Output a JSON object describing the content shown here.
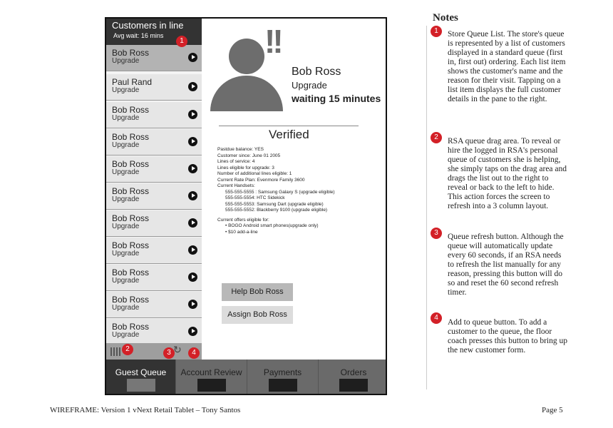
{
  "queue": {
    "title": "Customers in line",
    "avg_wait": "Avg wait: 16 mins",
    "items": [
      {
        "name": "Bob Ross",
        "reason": "Upgrade"
      },
      {
        "name": "Paul Rand",
        "reason": "Upgrade"
      },
      {
        "name": "Bob Ross",
        "reason": "Upgrade"
      },
      {
        "name": "Bob Ross",
        "reason": "Upgrade"
      },
      {
        "name": "Bob Ross",
        "reason": "Upgrade"
      },
      {
        "name": "Bob Ross",
        "reason": "Upgrade"
      },
      {
        "name": "Bob Ross",
        "reason": "Upgrade"
      },
      {
        "name": "Bob Ross",
        "reason": "Upgrade"
      },
      {
        "name": "Bob Ross",
        "reason": "Upgrade"
      },
      {
        "name": "Bob Ross",
        "reason": "Upgrade"
      },
      {
        "name": "Bob Ross",
        "reason": "Upgrade"
      }
    ]
  },
  "customer": {
    "name": "Bob Ross",
    "reason": "Upgrade",
    "wait": "waiting 15 minutes",
    "status": "Verified",
    "details": [
      "Pastdue balance: YES",
      "Customer since: June 01 2005",
      "Lines of service: 4",
      "Lines eligible for upgrade: 3",
      "Number of additional lines eligible: 1",
      "Current Rate Plan: Evenmore Family 3600",
      "Current Handsets:"
    ],
    "handsets": [
      "555-555-5555 : Samsung Galaxy S (upgrade eligible)",
      "555-555-5554: HTC Sidekick",
      "555-555-5553: Samsung Dart (upgrade eligible)",
      "555-555-5552: Blackberry 9100 (upgrade eligible)"
    ],
    "offers_title": "Current offers eligible for:",
    "offers": [
      "• BOGO Android smart phones(upgrade only)",
      "• $10 add-a-line"
    ],
    "help_button": "Help Bob Ross",
    "assign_button": "Assign Bob Ross"
  },
  "tabs": [
    "Guest Queue",
    "Account Review",
    "Payments",
    "Orders"
  ],
  "callouts": [
    "1",
    "2",
    "3",
    "4"
  ],
  "notes": {
    "title": "Notes",
    "items": [
      "Store Queue List. The store's queue is represented by a list of customers displayed in a standard queue (first in, first out) ordering. Each list item shows the customer's name and the reason for their visit. Tapping on a list item displays the full customer details in the pane to the right.",
      "RSA queue drag area. To reveal or hire the logged in RSA's personal queue of customers she is helping, she simply taps on the drag area and drags the list out to the right to reveal or back to the left to hide. This action forces the screen to refresh into a 3 column layout.",
      "Queue refresh button. Although the queue will automatically update every 60 seconds, if an RSA needs to refresh the list manually for any reason, pressing this button will do so and reset the 60 second refresh timer.",
      "Add to queue button. To add a customer to the queue, the floor coach presses this button to bring up the new customer form."
    ]
  },
  "footer": {
    "left": "WIREFRAME: Version 1 vNext Retail Tablet – Tony Santos",
    "right": "Page 5"
  },
  "colors": {
    "callout": "#d32027",
    "header": "#333333",
    "tabbar": "#6a6a6a"
  },
  "icons": [
    "play-icon",
    "drag-handle-icon",
    "refresh-icon",
    "add-icon",
    "person-avatar-icon",
    "alert-icon"
  ]
}
